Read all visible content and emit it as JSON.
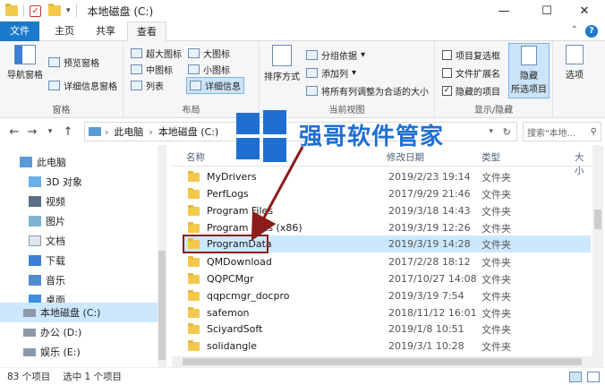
{
  "titlebar": {
    "title": "本地磁盘 (C:)",
    "check_icon": "✓",
    "minimize": "—",
    "maximize": "☐",
    "close": "✕"
  },
  "tabs": {
    "file": "文件",
    "home": "主页",
    "share": "共享",
    "view": "查看"
  },
  "ribbon": {
    "nav_pane": "导航窗格",
    "preview_pane": "预览窗格",
    "details_pane": "详细信息窗格",
    "panes_group": "窗格",
    "xl_icons": "超大图标",
    "large_icons": "大图标",
    "medium_icons": "中图标",
    "small_icons": "小图标",
    "list": "列表",
    "details": "详细信息",
    "layout_group": "布局",
    "sort_by": "排序方式",
    "group_by": "分组依据",
    "add_columns": "添加列",
    "size_all_columns": "将所有列调整为合适的大小",
    "current_view_group": "当前视图",
    "item_checkboxes": "项目复选框",
    "file_extensions": "文件扩展名",
    "hidden_items": "隐藏的项目",
    "hide_selected_1": "隐藏",
    "hide_selected_2": "所选项目",
    "showhide_group": "显示/隐藏",
    "options": "选项"
  },
  "address": {
    "crumb_pc": "此电脑",
    "crumb_drive": "本地磁盘 (C:)",
    "search_placeholder": "搜索\"本地..."
  },
  "nav": [
    {
      "label": "此电脑",
      "icon": "computer-icon"
    },
    {
      "label": "3D 对象",
      "icon": "cube-icon"
    },
    {
      "label": "视频",
      "icon": "video-icon"
    },
    {
      "label": "图片",
      "icon": "picture-icon"
    },
    {
      "label": "文档",
      "icon": "document-icon"
    },
    {
      "label": "下载",
      "icon": "download-icon"
    },
    {
      "label": "音乐",
      "icon": "music-icon"
    },
    {
      "label": "桌面",
      "icon": "desktop-icon"
    },
    {
      "label": "本地磁盘 (C:)",
      "icon": "drive-icon"
    },
    {
      "label": "办公 (D:)",
      "icon": "drive-icon"
    },
    {
      "label": "娱乐 (E:)",
      "icon": "drive-icon"
    }
  ],
  "columns": {
    "name": "名称",
    "date": "修改日期",
    "type": "类型",
    "size": "大小"
  },
  "files": [
    {
      "name": "MyDrivers",
      "date": "2019/2/23 19:14",
      "type": "文件夹"
    },
    {
      "name": "PerfLogs",
      "date": "2017/9/29 21:46",
      "type": "文件夹"
    },
    {
      "name": "Program Files",
      "date": "2019/3/18 14:43",
      "type": "文件夹"
    },
    {
      "name": "Program Files (x86)",
      "date": "2019/3/19 12:26",
      "type": "文件夹"
    },
    {
      "name": "ProgramData",
      "date": "2019/3/19 14:28",
      "type": "文件夹"
    },
    {
      "name": "QMDownload",
      "date": "2017/2/28 18:12",
      "type": "文件夹"
    },
    {
      "name": "QQPCMgr",
      "date": "2017/10/27 14:08",
      "type": "文件夹"
    },
    {
      "name": "qqpcmgr_docpro",
      "date": "2019/3/19 7:54",
      "type": "文件夹"
    },
    {
      "name": "safemon",
      "date": "2018/11/12 16:01",
      "type": "文件夹"
    },
    {
      "name": "SciyardSoft",
      "date": "2019/1/8 10:51",
      "type": "文件夹"
    },
    {
      "name": "solidangle",
      "date": "2019/3/1 10:28",
      "type": "文件夹"
    }
  ],
  "status": {
    "count": "83 个项目",
    "selected": "选中 1 个项目"
  },
  "watermark": {
    "text": "强哥软件管家"
  },
  "colors": {
    "accent": "#1979ca",
    "selection": "#cce8ff",
    "highlight": "#8b1c1c",
    "folder": "#f2c94c"
  }
}
